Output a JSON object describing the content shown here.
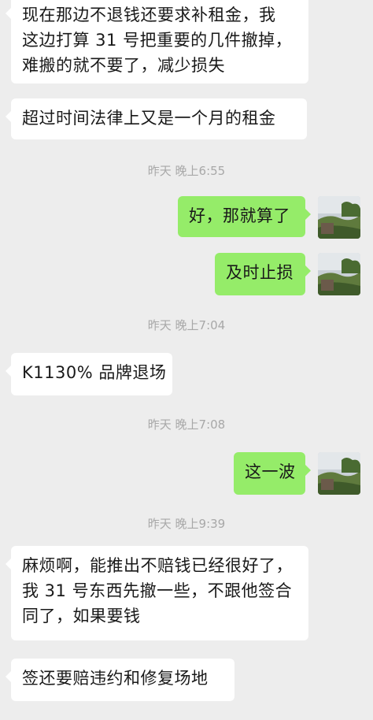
{
  "messages": [
    {
      "side": "in",
      "lines": [
        "现在那边不退钱还要求补租金，我",
        "这边打算 31 号把重要的几件撤掉，",
        "难搬的就不要了，减少损失"
      ]
    },
    {
      "side": "in",
      "lines": [
        "超过时间法律上又是一个月的租金"
      ]
    },
    {
      "side": "time",
      "text": "昨天 晚上6:55"
    },
    {
      "side": "out",
      "lines": [
        "好，那就算了"
      ]
    },
    {
      "side": "out",
      "lines": [
        "及时止损"
      ]
    },
    {
      "side": "time",
      "text": "昨天 晚上7:04"
    },
    {
      "side": "in",
      "lines": [
        "K1130% 品牌退场"
      ]
    },
    {
      "side": "time",
      "text": "昨天 晚上7:08"
    },
    {
      "side": "out",
      "lines": [
        "这一波"
      ]
    },
    {
      "side": "time",
      "text": "昨天 晚上9:39"
    },
    {
      "side": "in",
      "lines": [
        "麻烦啊，能推出不赔钱已经很好了，",
        "我 31 号东西先撤一些，不跟他签合",
        "同了，如果要钱"
      ]
    },
    {
      "side": "in",
      "lines": [
        "签还要赔违约和修复场地"
      ]
    }
  ],
  "avatar": {
    "icon": "landscape-avatar-icon"
  },
  "colors": {
    "background": "#ededed",
    "incoming": "#ffffff",
    "outgoing": "#95ec69",
    "timestamp": "#a8a8a8"
  }
}
